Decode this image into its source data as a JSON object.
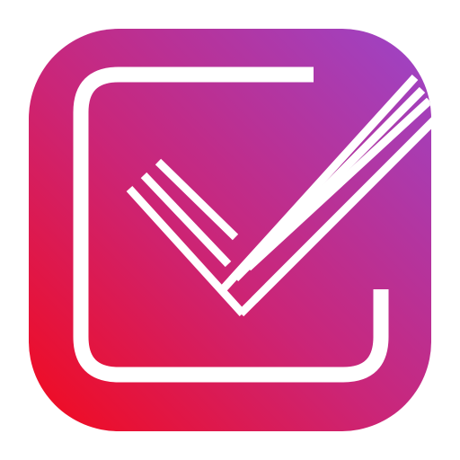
{
  "icon": {
    "name": "checklist-app-icon",
    "colors": {
      "gradient_bottom_left": "#f30a1c",
      "gradient_mid": "#cb2577",
      "gradient_top_right": "#9b45c9",
      "glyph": "#ffffff"
    }
  }
}
